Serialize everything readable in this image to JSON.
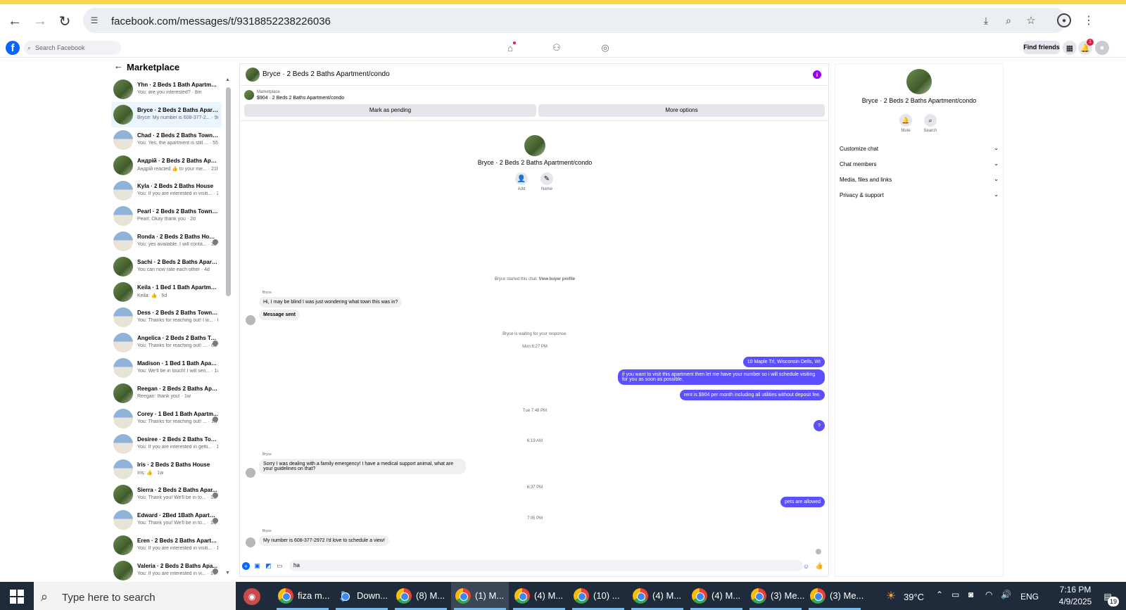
{
  "browser": {
    "url": "facebook.com/messages/t/9318852238226036"
  },
  "fb": {
    "search_placeholder": "Search Facebook",
    "find_friends": "Find friends",
    "notif_count": "1"
  },
  "sidebar": {
    "title": "Marketplace",
    "conversations": [
      {
        "title": "Yhn · 2 Beds 1 Bath Apartmen...",
        "snippet": "You: are you interested?",
        "time": "8m"
      },
      {
        "title": "Bryce · 2 Beds 2 Baths Apartm...",
        "snippet": "Bryce: My number is 608-377-2...",
        "time": "9m"
      },
      {
        "title": "Chad · 2 Beds 2 Baths Townho...",
        "snippet": "You: Yes, the apartment is still ...",
        "time": "55m"
      },
      {
        "title": "Андрій · 2 Beds 2 Baths Apart...",
        "snippet": "Андрій reacted 👍 to your me...",
        "time": "21h"
      },
      {
        "title": "Kyla · 2 Beds 2 Baths House",
        "snippet": "You: If you are interested in visiti...",
        "time": "2d"
      },
      {
        "title": "Pearl · 2 Beds 2 Baths Townho...",
        "snippet": "Pearl: Okay thank you",
        "time": "2d"
      },
      {
        "title": "Ronda · 2 Beds 2 Baths House",
        "snippet": "You: yes available. I will conta...",
        "time": "3d"
      },
      {
        "title": "Sachi · 2 Beds 2 Baths Apartm...",
        "snippet": "You can now rate each other",
        "time": "4d"
      },
      {
        "title": "Keila · 1 Bed 1 Bath Apartment...",
        "snippet": "Keila: 👍",
        "time": "6d"
      },
      {
        "title": "Dess · 2 Beds 2 Baths Townho...",
        "snippet": "You: Thanks for reaching out! I w...",
        "time": "6d"
      },
      {
        "title": "Angelica · 2 Beds 2 Baths To...",
        "snippet": "You: Thanks for reaching out! ...",
        "time": "6d"
      },
      {
        "title": "Madison · 1 Bed 1 Bath Apart...",
        "snippet": "You: We'll be in touch! I will sen...",
        "time": "1w"
      },
      {
        "title": "Reegan · 2 Beds 2 Baths Apart...",
        "snippet": "Reegan: thank you!",
        "time": "1w"
      },
      {
        "title": "Corey · 1 Bed 1 Bath Apartm...",
        "snippet": "You: Thanks for reaching out! ...",
        "time": "1w"
      },
      {
        "title": "Desiree · 2 Beds 2 Baths Town...",
        "snippet": "You: If you are interested in getti...",
        "time": "1w"
      },
      {
        "title": "Iris · 2 Beds 2 Baths House",
        "snippet": "Iris: 👍",
        "time": "1w"
      },
      {
        "title": "Sierra · 2 Beds 2 Baths Apar...",
        "snippet": "You: Thank you! We'll be in to...",
        "time": "1w"
      },
      {
        "title": "Edward · 2Bed 1Bath Apartm...",
        "snippet": "You: Thank you! We'll be in to...",
        "time": "1w"
      },
      {
        "title": "Eren · 2 Beds 2 Baths Apartme...",
        "snippet": "You: If you are interested in visiti...",
        "time": "1w"
      },
      {
        "title": "Valeria · 2 Beds 2 Baths Apa...",
        "snippet": "You: If you are interested in vi...",
        "time": "1w"
      }
    ]
  },
  "chat": {
    "title": "Bryce · 2 Beds 2 Baths Apartment/condo",
    "marketplace_label": "Marketplace",
    "listing": "$904 · 2 Beds 2 Baths Apartment/condo",
    "mark_pending": "Mark as pending",
    "more_options": "More options",
    "profile_name": "Bryce · 2 Beds 2 Baths Apartment/condo",
    "add_label": "Add",
    "name_label": "Name",
    "started": "Bryce started this chat.",
    "view_profile": "View buyer profile",
    "sender": "Bryce",
    "msg1": "Hi, I may be blind I was just wondering what town this was in?",
    "msg2": "Message sent",
    "waiting": "Bryce is waiting for your response.",
    "ts1": "Mon 6:27 PM",
    "out1": "10 Maple Trl, Wisconsin Dells, WI",
    "out2": "if you want to visit this apartment then let me have your number so i will schedule visiting for you as soon as possible.",
    "out3": "rent is $904 per month including all utilities without deposit fee.",
    "ts2": "Tue 7:48 PM",
    "out4": "?",
    "ts3": "6:19 AM",
    "msg3": "Sorry I was dealing with a family emergency! I have a medical support animal, what are your guidelines on that?",
    "ts4": "6:37 PM",
    "out5": "pets are allowed",
    "ts5": "7:05 PM",
    "msg4": "My number is 608-377-2972 I'd love to schedule a view!",
    "composer_value": "ha"
  },
  "details": {
    "name": "Bryce · 2 Beds 2 Baths Apartment/condo",
    "mute": "Mute",
    "search": "Search",
    "rows": [
      "Customize chat",
      "Chat members",
      "Media, files and links",
      "Privacy & support"
    ]
  },
  "taskbar": {
    "search_placeholder": "Type here to search",
    "apps": [
      "fiza m...",
      "Down...",
      "(8) M...",
      "(1) M...",
      "(4) M...",
      "(10) ...",
      "(4) M...",
      "(4) M...",
      "(3) Me...",
      "(3) Me..."
    ],
    "weather": "39°C",
    "lang": "ENG",
    "time": "7:16 PM",
    "date": "4/9/2025",
    "notif_count": "19"
  }
}
